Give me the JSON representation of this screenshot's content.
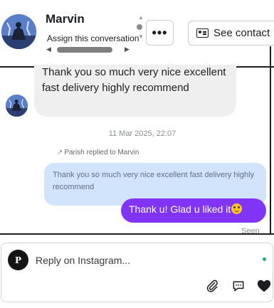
{
  "header": {
    "contact_name": "Marvin",
    "assign_label": "Assign this conversation",
    "more_label": "•••",
    "see_contact_label": "See contact"
  },
  "messages": {
    "incoming_text": "Thank you so much very nice excellent fast delivery highly recommend",
    "timestamp": "11 Mar 2025, 22:07",
    "reply_note": "Parish replied to Marvin",
    "quoted_text": "Thank you so much very nice excellent fast delivery highly recommend",
    "outgoing_text": "Thank u! Glad u liked it",
    "seen_label": "Seen"
  },
  "composer": {
    "placeholder": "Reply on Instagram...",
    "page_avatar_initial": "P"
  },
  "icons": [
    "contact-card-icon",
    "attach-icon",
    "quick-reply-icon",
    "heart-icon",
    "smile-emoji-icon"
  ],
  "colors": {
    "outgoing_bubble": "#8134f6",
    "quoted_bubble": "#d1e4fb",
    "incoming_bubble": "#efefef",
    "online_dot": "#1ab26b"
  }
}
